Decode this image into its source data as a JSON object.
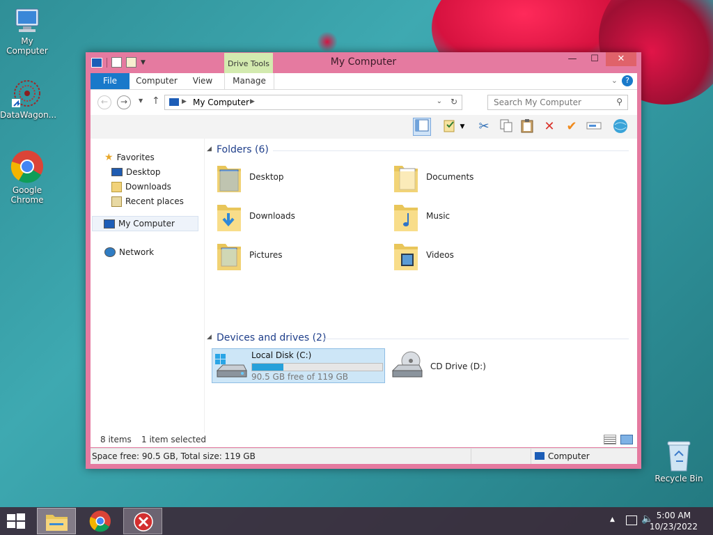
{
  "desktop": {
    "icons": [
      {
        "label": "My Computer"
      },
      {
        "label": "DataWagon..."
      },
      {
        "label": "Google Chrome"
      },
      {
        "label": "Recycle Bin"
      }
    ]
  },
  "window": {
    "title": "My Computer",
    "context_tab": "Drive Tools",
    "tabs": [
      "File",
      "Computer",
      "View",
      "Manage"
    ],
    "address": "My Computer",
    "search_placeholder": "Search My Computer"
  },
  "navpane": {
    "favorites": "Favorites",
    "items": [
      "Desktop",
      "Downloads",
      "Recent places"
    ],
    "computer": "My Computer",
    "network": "Network"
  },
  "folders": {
    "header": "Folders (6)",
    "items": [
      "Desktop",
      "Documents",
      "Downloads",
      "Music",
      "Pictures",
      "Videos"
    ]
  },
  "drives": {
    "header": "Devices and drives (2)",
    "local": {
      "name": "Local Disk (C:)",
      "free": "90.5 GB free of 119 GB",
      "used_fraction": 0.24
    },
    "cd": {
      "name": "CD Drive (D:)"
    }
  },
  "status": {
    "items": "8 items",
    "selected": "1 item selected",
    "space": "Space free: 90.5 GB, Total size: 119 GB",
    "location": "Computer"
  },
  "taskbar": {
    "time": "5:00 AM",
    "date": "10/23/2022"
  },
  "colors": {
    "window_frame": "#e57aa0",
    "accent": "#1979ca",
    "drive_tools": "#d3eaaf"
  }
}
